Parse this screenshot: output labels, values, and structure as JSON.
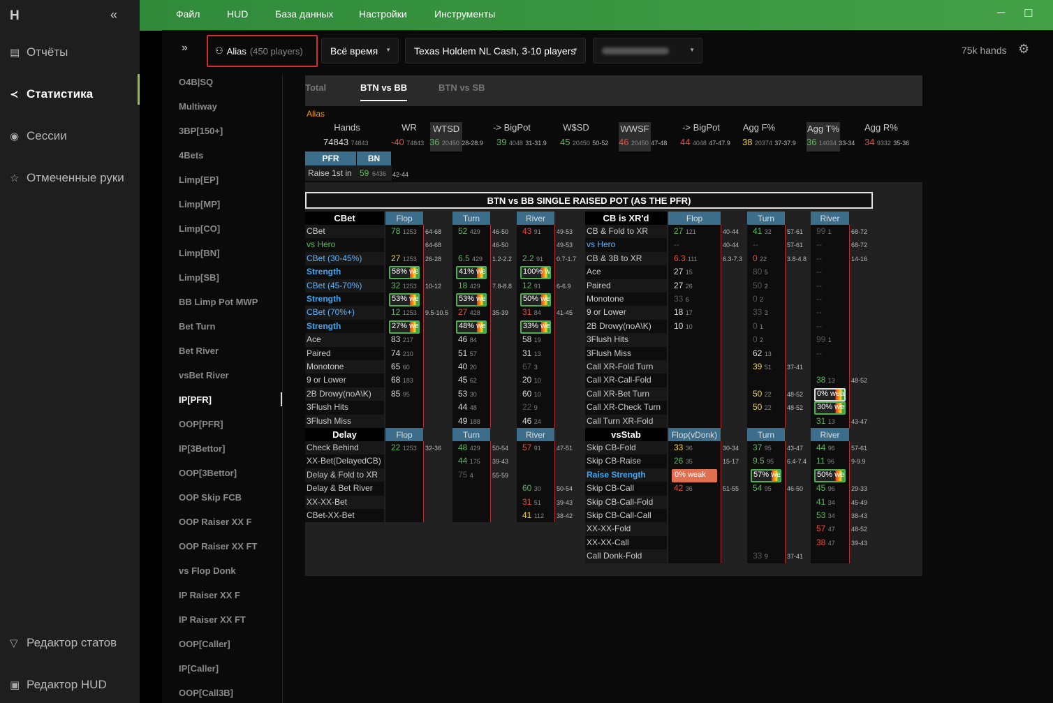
{
  "app": {
    "logo": "H",
    "collapse": "«"
  },
  "nav": [
    {
      "label": "Отчёты",
      "icon": "report-icon"
    },
    {
      "label": "Статистика",
      "icon": "stats-icon"
    },
    {
      "label": "Сессии",
      "icon": "sessions-icon"
    },
    {
      "label": "Отмеченные руки",
      "icon": "star-icon"
    }
  ],
  "nav_bottom": [
    {
      "label": "Редактор статов",
      "icon": "filter-icon"
    },
    {
      "label": "Редактор HUD",
      "icon": "hud-icon"
    }
  ],
  "menu": [
    "Файл",
    "HUD",
    "База данных",
    "Настройки",
    "Инструменты"
  ],
  "controls": {
    "alias": "Alias",
    "players": "(450 players)",
    "period": "Всё время",
    "game": "Texas Holdem NL Cash, 3-10 players",
    "hands": "75k hands"
  },
  "subnav": [
    "O4B|SQ",
    "Multiway",
    "3BP[150+]",
    "4Bets",
    "Limp[EP]",
    "Limp[MP]",
    "Limp[CO]",
    "Limp[BN]",
    "Limp[SB]",
    "BB Limp Pot MWP",
    "Bet Turn",
    "Bet River",
    "vsBet River",
    "IP[PFR]",
    "OOP[PFR]",
    "IP[3Bettor]",
    "OOP[3Bettor]",
    "OOP Skip FCB",
    "OOP Raiser XX F",
    "OOP Raiser XX FT",
    "vs Flop Donk",
    "IP Raiser XX F",
    "IP Raiser XX FT",
    "OOP[Caller]",
    "IP[Caller]",
    "OOP[Call3B]"
  ],
  "tabs": [
    "Total",
    "BTN vs BB",
    "BTN vs SB"
  ],
  "alias_label": "Alias",
  "summary": {
    "heads": [
      "Hands",
      "WR",
      "WTSD",
      "-> BigPot",
      "W$SD",
      "WWSF",
      "-> BigPot",
      "Agg F%",
      "Agg T%",
      "Agg R%"
    ],
    "vals": [
      [
        "74843",
        "74843",
        ""
      ],
      [
        "-40",
        "74843",
        ""
      ],
      [
        "36",
        "20450",
        "28-28.9"
      ],
      [
        "39",
        "4048",
        "31-31.9"
      ],
      [
        "45",
        "20450",
        "50-52"
      ],
      [
        "46",
        "20450",
        "47-48"
      ],
      [
        "44",
        "4048",
        "47-47.9"
      ],
      [
        "38",
        "20374",
        "37-37.9"
      ],
      [
        "36",
        "14034",
        "33-34"
      ],
      [
        "34",
        "9332",
        "35-36"
      ]
    ]
  },
  "pfr": {
    "h1": "PFR",
    "h2": "BN",
    "label": "Raise 1st in",
    "v": "59",
    "s": "6436",
    "rng": "42-44"
  },
  "section_title": "BTN vs BB SINGLE RAISED POT (AS THE PFR)",
  "col_heads": {
    "flop": "Flop",
    "turn": "Turn",
    "river": "River",
    "flopv": "Flop(vDonk)"
  },
  "groups": {
    "cbet": "CBet",
    "cbxr": "CB is XR'd",
    "delay": "Delay",
    "vsstab": "vsStab"
  },
  "left": [
    {
      "l": "CBet",
      "f": [
        "78",
        "1253",
        "g"
      ],
      "fr": "64-68",
      "t": [
        "52",
        "429",
        "g"
      ],
      "tr": "46-50",
      "r": [
        "43",
        "91",
        "r"
      ],
      "rr": "49-53"
    },
    {
      "l": "vs Hero",
      "c": "g",
      "f": null,
      "fr": "64-68",
      "t": null,
      "tr": "46-50",
      "r": null,
      "rr": "49-53"
    },
    {
      "l": "CBet (30-45%)",
      "c": "blue2",
      "f": [
        "27",
        "1253",
        "y"
      ],
      "fr": "26-28",
      "t": [
        "6.5",
        "429",
        "g"
      ],
      "tr": "1.2-2.2",
      "r": [
        "2.2",
        "91",
        "g"
      ],
      "rr": "0.7-1.7"
    },
    {
      "l": "Strength",
      "b": 1,
      "fb": "58% weak",
      "tb": "41% weak",
      "rb": "100% weak"
    },
    {
      "l": "CBet (45-70%)",
      "c": "blue2",
      "f": [
        "32",
        "1253",
        "g"
      ],
      "fr": "10-12",
      "t": [
        "18",
        "429",
        "g"
      ],
      "tr": "7.8-8.8",
      "r": [
        "12",
        "91",
        "g"
      ],
      "rr": "6-6.9"
    },
    {
      "l": "Strength",
      "b": 1,
      "fb": "53% weak",
      "tb": "53% weak",
      "rb": "50% weak"
    },
    {
      "l": "CBet (70%+)",
      "c": "blue2",
      "f": [
        "12",
        "1253",
        "g"
      ],
      "fr": "9.5-10.5",
      "t": [
        "27",
        "428",
        "r"
      ],
      "tr": "35-39",
      "r": [
        "31",
        "84",
        "r"
      ],
      "rr": "41-45"
    },
    {
      "l": "Strength",
      "b": 1,
      "fb": "27% weak",
      "tb": "48% weak",
      "rb": "33% weak"
    },
    {
      "l": "Ace",
      "f": [
        "83",
        "217",
        "w"
      ],
      "t": [
        "46",
        "84",
        "w"
      ],
      "r": [
        "58",
        "19",
        "w"
      ]
    },
    {
      "l": "Paired",
      "f": [
        "74",
        "210",
        "w"
      ],
      "t": [
        "51",
        "57",
        "w"
      ],
      "r": [
        "31",
        "13",
        "w"
      ]
    },
    {
      "l": "Monotone",
      "f": [
        "65",
        "60",
        "w"
      ],
      "t": [
        "40",
        "20",
        "w"
      ],
      "r": [
        "67",
        "3",
        "gr"
      ]
    },
    {
      "l": "9 or Lower",
      "f": [
        "68",
        "183",
        "w"
      ],
      "t": [
        "45",
        "62",
        "w"
      ],
      "r": [
        "20",
        "10",
        "w"
      ]
    },
    {
      "l": "2B Drowy(noA\\K)",
      "f": [
        "85",
        "95",
        "w"
      ],
      "t": [
        "53",
        "30",
        "w"
      ],
      "r": [
        "60",
        "10",
        "w"
      ]
    },
    {
      "l": "3Flush Hits",
      "f": null,
      "t": [
        "44",
        "48",
        "w"
      ],
      "r": [
        "22",
        "9",
        "gr"
      ]
    },
    {
      "l": "3Flush Miss",
      "f": null,
      "t": [
        "49",
        "188",
        "w"
      ],
      "r": [
        "46",
        "24",
        "w"
      ]
    }
  ],
  "delay": [
    {
      "l": "Check Behind",
      "f": [
        "22",
        "1253",
        "g"
      ],
      "fr": "32-36",
      "t": [
        "48",
        "429",
        "g"
      ],
      "tr": "50-54",
      "r": [
        "57",
        "91",
        "r"
      ],
      "rr": "47-51"
    },
    {
      "l": "XX-Bet(DelayedCB)",
      "t": [
        "44",
        "175",
        "g"
      ],
      "tr": "39-43"
    },
    {
      "l": "Delay & Fold to XR",
      "t": [
        "75",
        "4",
        "gr"
      ],
      "tr": "55-59"
    },
    {
      "l": "Delay & Bet River",
      "r": [
        "60",
        "30",
        "g"
      ],
      "rr": "50-54"
    },
    {
      "l": "XX-XX-Bet",
      "r": [
        "31",
        "51",
        "r"
      ],
      "rr": "39-43"
    },
    {
      "l": "CBet-XX-Bet",
      "r": [
        "41",
        "112",
        "y"
      ],
      "rr": "38-42"
    }
  ],
  "right": [
    {
      "l": "CB & Fold to XR",
      "f": [
        "27",
        "121",
        "g"
      ],
      "fr": "40-44",
      "t": [
        "41",
        "32",
        "g"
      ],
      "tr": "57-61",
      "r": [
        "99",
        "1",
        "gr"
      ],
      "rr": "68-72"
    },
    {
      "l": "vs Hero",
      "c": "blue2",
      "f": [
        "--",
        "",
        "gr"
      ],
      "fr": "40-44",
      "t": [
        "--",
        "",
        "gr"
      ],
      "tr": "57-61",
      "r": [
        "--",
        "",
        "gr"
      ],
      "rr": "68-72"
    },
    {
      "l": "CB & 3B to XR",
      "f": [
        "6.3",
        "111",
        "r"
      ],
      "fr": "6.3-7.3",
      "t": [
        "0",
        "22",
        "r"
      ],
      "tr": "3.8-4.8",
      "r": [
        "--",
        "",
        "gr"
      ],
      "rr": "14-16"
    },
    {
      "l": "Ace",
      "f": [
        "27",
        "15",
        "w"
      ],
      "t": [
        "80",
        "5",
        "gr"
      ],
      "r": [
        "--",
        "",
        "gr"
      ]
    },
    {
      "l": "Paired",
      "f": [
        "27",
        "26",
        "w"
      ],
      "t": [
        "50",
        "2",
        "gr"
      ],
      "r": [
        "--",
        "",
        "gr"
      ]
    },
    {
      "l": "Monotone",
      "f": [
        "33",
        "6",
        "gr"
      ],
      "t": [
        "0",
        "2",
        "gr"
      ],
      "r": [
        "--",
        "",
        "gr"
      ]
    },
    {
      "l": "9 or Lower",
      "f": [
        "18",
        "17",
        "w"
      ],
      "t": [
        "33",
        "3",
        "gr"
      ],
      "r": [
        "--",
        "",
        "gr"
      ]
    },
    {
      "l": "2B Drowy(noA\\K)",
      "f": [
        "10",
        "10",
        "w"
      ],
      "t": [
        "0",
        "1",
        "gr"
      ],
      "r": [
        "--",
        "",
        "gr"
      ]
    },
    {
      "l": "3Flush Hits",
      "t": [
        "0",
        "2",
        "gr"
      ],
      "r": [
        "99",
        "1",
        "gr"
      ]
    },
    {
      "l": "3Flush Miss",
      "t": [
        "62",
        "13",
        "w"
      ],
      "r": [
        "--",
        "",
        "gr"
      ]
    },
    {
      "l": "Call XR-Fold Turn",
      "t": [
        "39",
        "51",
        "y"
      ],
      "tr": "37-41"
    },
    {
      "l": "Call XR-Call-Fold",
      "r": [
        "38",
        "13",
        "g"
      ],
      "rr": "48-52"
    },
    {
      "l": "Call XR-Bet Turn",
      "t": [
        "50",
        "22",
        "y"
      ],
      "tr": "48-52",
      "rb": "0% weak",
      "rbw": 1
    },
    {
      "l": "Call XR-Check Turn",
      "t": [
        "50",
        "22",
        "y"
      ],
      "tr": "48-52",
      "rb": "30% weak"
    },
    {
      "l": "Call Turn XR-Fold",
      "r": [
        "31",
        "13",
        "g"
      ],
      "rr": "43-47"
    }
  ],
  "vsstab": [
    {
      "l": "Skip CB-Fold",
      "f": [
        "33",
        "36",
        "y"
      ],
      "fr": "30-34",
      "t": [
        "37",
        "95",
        "g"
      ],
      "tr": "43-47",
      "r": [
        "44",
        "96",
        "g"
      ],
      "rr": "57-61"
    },
    {
      "l": "Skip CB-Raise",
      "f": [
        "26",
        "35",
        "g"
      ],
      "fr": "15-17",
      "t": [
        "9.5",
        "95",
        "g"
      ],
      "tr": "6.4-7.4",
      "r": [
        "11",
        "96",
        "g"
      ],
      "rr": "9-9.9"
    },
    {
      "l": "Raise Strength",
      "b": 1,
      "fb": "0% weak",
      "fbred": 1,
      "tb": "57% weak",
      "rb": "50% weak"
    },
    {
      "l": "Skip CB-Call",
      "f": [
        "42",
        "36",
        "r"
      ],
      "fr": "51-55",
      "t": [
        "54",
        "95",
        "g"
      ],
      "tr": "46-50",
      "r": [
        "45",
        "96",
        "g"
      ],
      "rr": "29-33"
    },
    {
      "l": "Skip CB-Call-Fold",
      "r": [
        "41",
        "34",
        "g"
      ],
      "rr": "45-49"
    },
    {
      "l": "Skip CB-Call-Call",
      "r": [
        "53",
        "34",
        "g"
      ],
      "rr": "38-43"
    },
    {
      "l": "XX-XX-Fold",
      "r": [
        "57",
        "47",
        "r"
      ],
      "rr": "48-52"
    },
    {
      "l": "XX-XX-Call",
      "r": [
        "38",
        "47",
        "r"
      ],
      "rr": "39-43"
    },
    {
      "l": "Call Donk-Fold",
      "t": [
        "33",
        "9",
        "gr"
      ],
      "tr": "37-41"
    }
  ],
  "colors": {
    "accent": "#43a047",
    "header_blue": "#3c6e8c",
    "highlight": "#d32f2f"
  }
}
